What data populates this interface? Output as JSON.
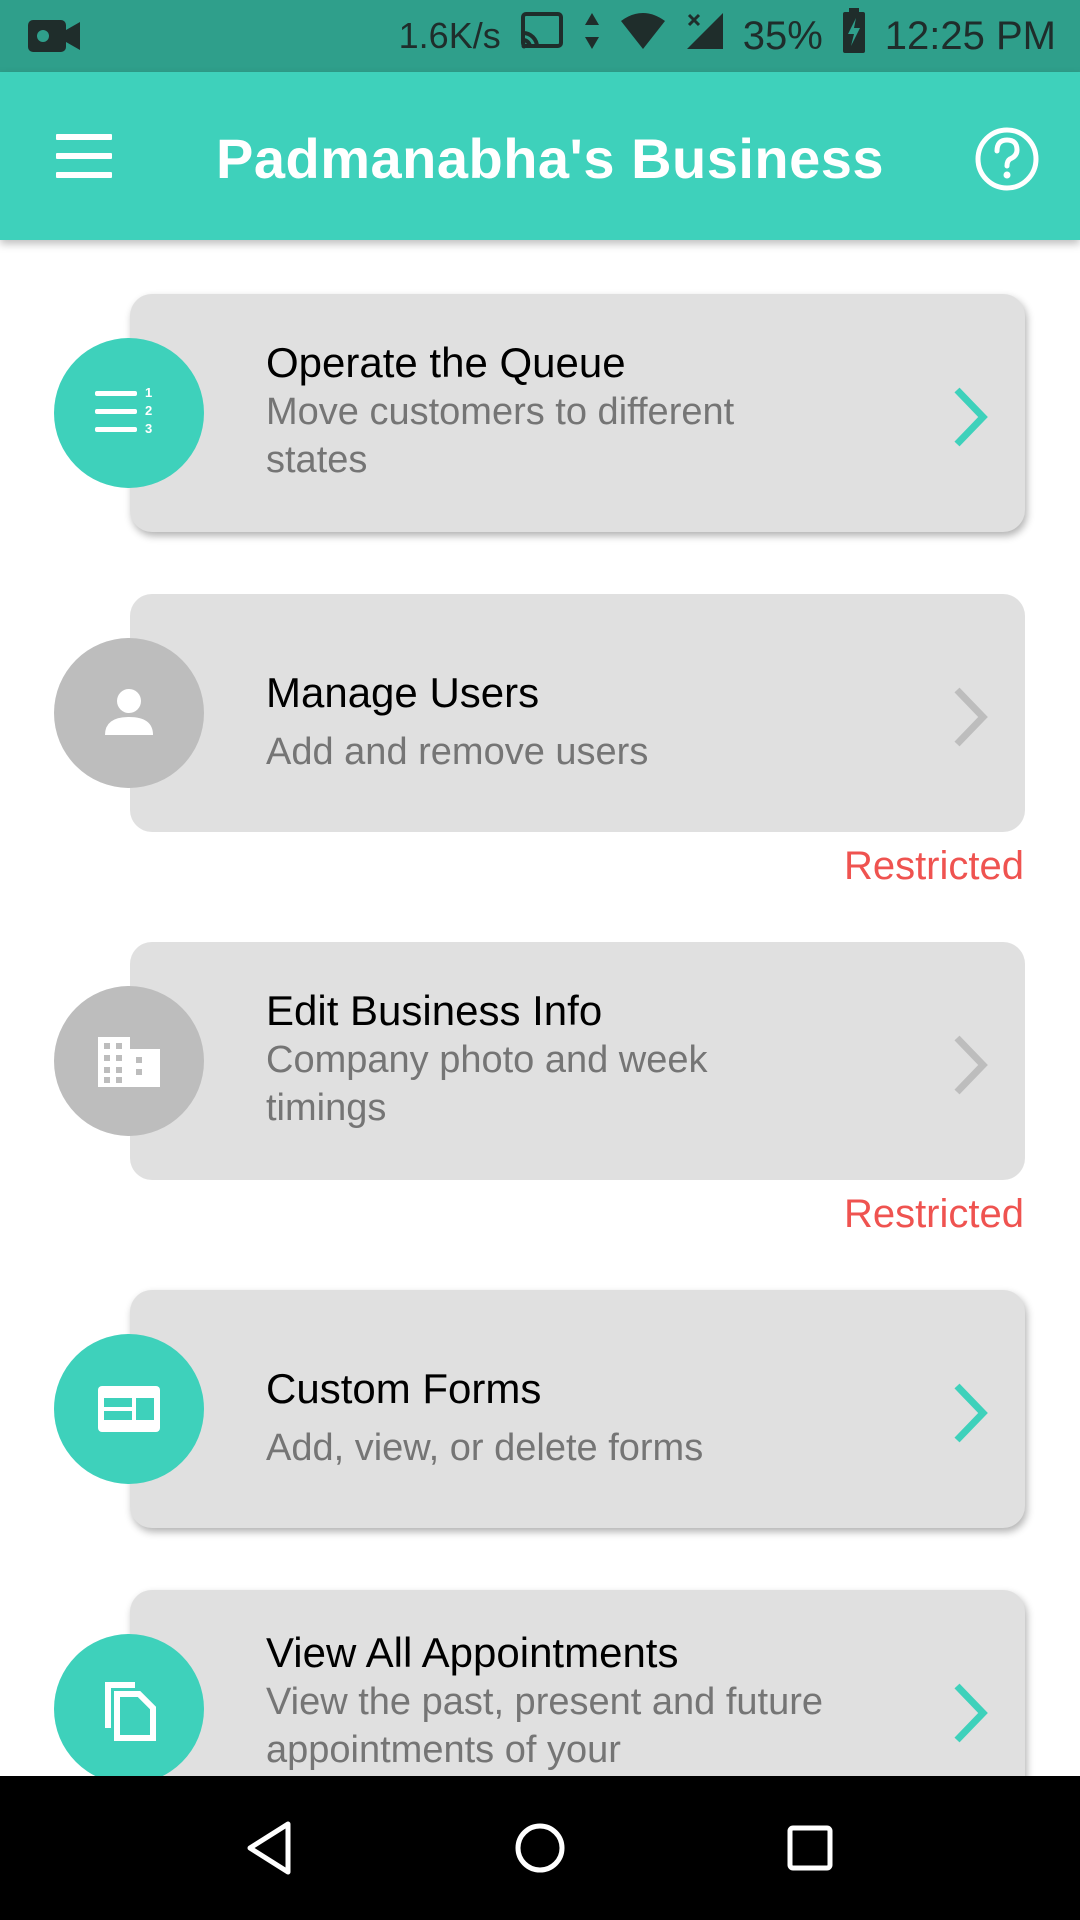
{
  "status_bar": {
    "net_speed": "1.6K/s",
    "battery": "35%",
    "time": "12:25 PM"
  },
  "app_bar": {
    "title": "Padmanabha's Business",
    "menu_icon": "menu-icon",
    "help_icon": "help-circle-icon"
  },
  "colors": {
    "accent": "#3ed1bb",
    "status_bar": "#2f9f8b",
    "card": "#e0e0e0",
    "disabled": "#bdbdbd",
    "restricted": "#ef5350"
  },
  "menu": {
    "items": [
      {
        "title": "Operate the Queue",
        "subtitle": "Move customers to different states",
        "icon": "numbered-list-icon",
        "restricted": false
      },
      {
        "title": "Manage Users",
        "subtitle": "Add and remove users",
        "icon": "person-icon",
        "restricted": true,
        "restricted_label": "Restricted"
      },
      {
        "title": "Edit Business Info",
        "subtitle": "Company photo and week timings",
        "icon": "building-icon",
        "restricted": true,
        "restricted_label": "Restricted"
      },
      {
        "title": "Custom Forms",
        "subtitle": "Add, view, or delete forms",
        "icon": "form-icon",
        "restricted": false
      },
      {
        "title": "View All Appointments",
        "subtitle": "View the past, present and future appointments of your",
        "icon": "copy-icon",
        "restricted": false
      }
    ]
  }
}
